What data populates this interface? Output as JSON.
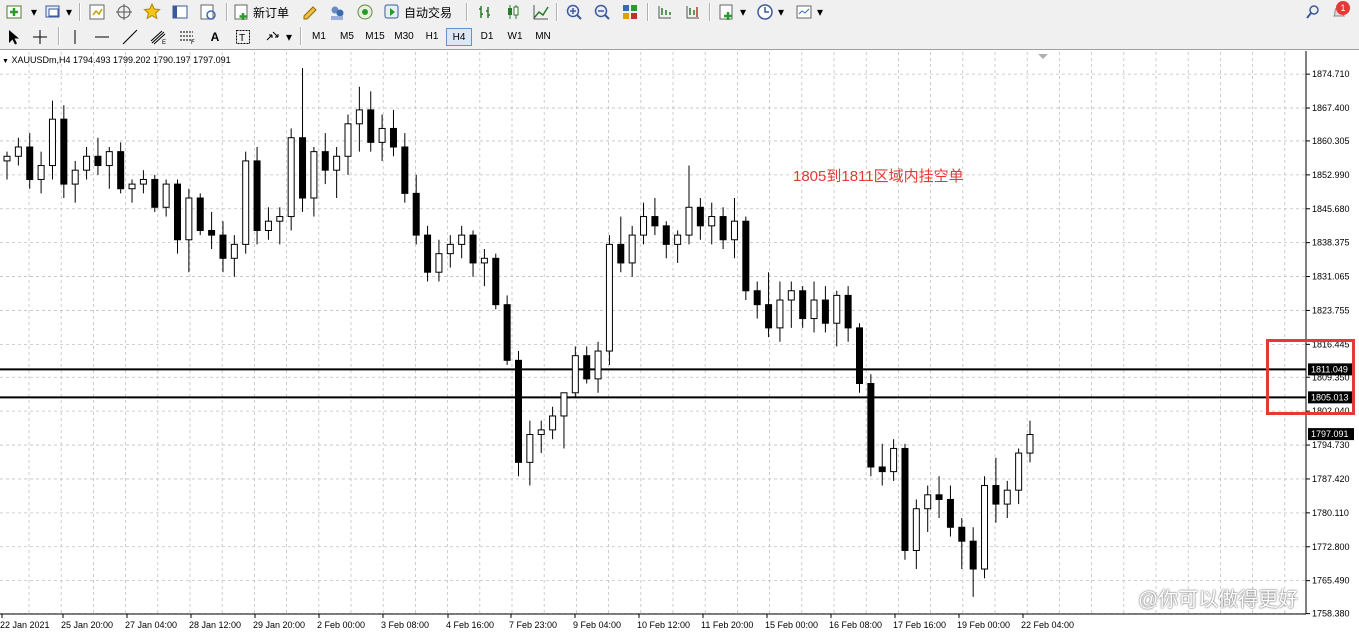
{
  "toolbar": {
    "new_order_label": "新订单",
    "auto_trading_label": "自动交易",
    "notification_count": "1"
  },
  "timeframes": [
    "M1",
    "M5",
    "M15",
    "M30",
    "H1",
    "H4",
    "D1",
    "W1",
    "MN"
  ],
  "active_timeframe": "H4",
  "chart": {
    "header": "XAUUSDm,H4  1794.493 1799.202 1790.197 1797.091",
    "annotation": "1805到1811区域内挂空单",
    "watermark": "@你可以做得更好",
    "current_price_label": "1797.091",
    "line_labels": [
      "1811.049",
      "1805.013"
    ],
    "colors": {
      "background": "#ffffff",
      "grid": "#c0c0c0",
      "candle": "#000000",
      "annotation": "#e53935",
      "highlight": "#e53935"
    }
  },
  "chart_data": {
    "type": "candlestick",
    "symbol": "XAUUSDm",
    "timeframe": "H4",
    "ylim": [
      1758.3,
      1879.7
    ],
    "y_ticks": [
      "1874.710",
      "1867.400",
      "1860.305",
      "1852.990",
      "1845.680",
      "1838.375",
      "1831.065",
      "1823.755",
      "1816.445",
      "1809.350",
      "1802.040",
      "1794.730",
      "1787.420",
      "1780.110",
      "1772.800",
      "1765.490",
      "1758.380"
    ],
    "x_ticks": [
      "22 Jan 2021",
      "25 Jan 20:00",
      "27 Jan 04:00",
      "28 Jan 12:00",
      "29 Jan 20:00",
      "2 Feb 00:00",
      "3 Feb 08:00",
      "4 Feb 16:00",
      "7 Feb 23:00",
      "9 Feb 04:00",
      "10 Feb 12:00",
      "11 Feb 20:00",
      "15 Feb 00:00",
      "16 Feb 08:00",
      "17 Feb 16:00",
      "19 Feb 00:00",
      "22 Feb 04:00"
    ],
    "horizontal_lines": [
      1811.049,
      1805.013
    ],
    "last_price": 1797.091,
    "ohlc": [
      [
        1856,
        1858,
        1852,
        1857
      ],
      [
        1857,
        1861,
        1855,
        1859
      ],
      [
        1859,
        1862,
        1850,
        1852
      ],
      [
        1852,
        1858,
        1849,
        1855
      ],
      [
        1855,
        1869,
        1852,
        1865
      ],
      [
        1865,
        1868,
        1848,
        1851
      ],
      [
        1851,
        1856,
        1847,
        1854
      ],
      [
        1854,
        1859,
        1852,
        1857
      ],
      [
        1857,
        1861,
        1853,
        1855
      ],
      [
        1855,
        1859,
        1850,
        1858
      ],
      [
        1858,
        1860,
        1849,
        1850
      ],
      [
        1850,
        1852,
        1847,
        1851
      ],
      [
        1851,
        1854,
        1849,
        1852
      ],
      [
        1852,
        1853,
        1845,
        1846
      ],
      [
        1846,
        1852,
        1844,
        1851
      ],
      [
        1851,
        1852,
        1836,
        1839
      ],
      [
        1839,
        1850,
        1832,
        1848
      ],
      [
        1848,
        1849,
        1840,
        1841
      ],
      [
        1841,
        1845,
        1837,
        1840
      ],
      [
        1840,
        1843,
        1832,
        1835
      ],
      [
        1835,
        1840,
        1831,
        1838
      ],
      [
        1838,
        1858,
        1836,
        1856
      ],
      [
        1856,
        1859,
        1838,
        1841
      ],
      [
        1841,
        1846,
        1839,
        1843
      ],
      [
        1843,
        1846,
        1838,
        1844
      ],
      [
        1844,
        1863,
        1841,
        1861
      ],
      [
        1861,
        1876,
        1845,
        1848
      ],
      [
        1848,
        1859,
        1844,
        1858
      ],
      [
        1858,
        1862,
        1851,
        1854
      ],
      [
        1854,
        1859,
        1848,
        1857
      ],
      [
        1857,
        1866,
        1853,
        1864
      ],
      [
        1864,
        1872,
        1858,
        1867
      ],
      [
        1867,
        1871,
        1858,
        1860
      ],
      [
        1860,
        1866,
        1856,
        1863
      ],
      [
        1863,
        1867,
        1857,
        1859
      ],
      [
        1859,
        1862,
        1847,
        1849
      ],
      [
        1849,
        1853,
        1838,
        1840
      ],
      [
        1840,
        1842,
        1830,
        1832
      ],
      [
        1832,
        1839,
        1830,
        1836
      ],
      [
        1836,
        1840,
        1833,
        1838
      ],
      [
        1838,
        1842,
        1835,
        1840
      ],
      [
        1840,
        1841,
        1831,
        1834
      ],
      [
        1834,
        1837,
        1829,
        1835
      ],
      [
        1835,
        1836,
        1824,
        1825
      ],
      [
        1825,
        1827,
        1812,
        1813
      ],
      [
        1813,
        1815,
        1788,
        1791
      ],
      [
        1791,
        1800,
        1786,
        1797
      ],
      [
        1797,
        1800,
        1793,
        1798
      ],
      [
        1798,
        1803,
        1796,
        1801
      ],
      [
        1801,
        1806,
        1794,
        1806
      ],
      [
        1806,
        1816,
        1805,
        1814
      ],
      [
        1814,
        1816,
        1808,
        1809
      ],
      [
        1809,
        1817,
        1806,
        1815
      ],
      [
        1815,
        1840,
        1812,
        1838
      ],
      [
        1838,
        1844,
        1832,
        1834
      ],
      [
        1834,
        1842,
        1831,
        1840
      ],
      [
        1840,
        1847,
        1838,
        1844
      ],
      [
        1844,
        1848,
        1840,
        1842
      ],
      [
        1842,
        1843,
        1835,
        1838
      ],
      [
        1838,
        1841,
        1834,
        1840
      ],
      [
        1840,
        1855,
        1838,
        1846
      ],
      [
        1846,
        1848,
        1839,
        1842
      ],
      [
        1842,
        1847,
        1838,
        1844
      ],
      [
        1844,
        1846,
        1837,
        1839
      ],
      [
        1839,
        1848,
        1835,
        1843
      ],
      [
        1843,
        1844,
        1826,
        1828
      ],
      [
        1828,
        1830,
        1822,
        1825
      ],
      [
        1825,
        1832,
        1818,
        1820
      ],
      [
        1820,
        1830,
        1817,
        1826
      ],
      [
        1826,
        1830,
        1820,
        1828
      ],
      [
        1828,
        1829,
        1820,
        1822
      ],
      [
        1822,
        1830,
        1819,
        1826
      ],
      [
        1826,
        1829,
        1819,
        1821
      ],
      [
        1821,
        1828,
        1816,
        1827
      ],
      [
        1827,
        1829,
        1817,
        1820
      ],
      [
        1820,
        1821,
        1806,
        1808
      ],
      [
        1808,
        1810,
        1788,
        1790
      ],
      [
        1790,
        1795,
        1786,
        1789
      ],
      [
        1789,
        1796,
        1787,
        1794
      ],
      [
        1794,
        1795,
        1770,
        1772
      ],
      [
        1772,
        1783,
        1768,
        1781
      ],
      [
        1781,
        1786,
        1776,
        1784
      ],
      [
        1784,
        1788,
        1779,
        1783
      ],
      [
        1783,
        1786,
        1775,
        1777
      ],
      [
        1777,
        1779,
        1768,
        1774
      ],
      [
        1774,
        1777,
        1762,
        1768
      ],
      [
        1768,
        1788,
        1766,
        1786
      ],
      [
        1786,
        1792,
        1778,
        1782
      ],
      [
        1782,
        1787,
        1779,
        1785
      ],
      [
        1785,
        1794,
        1782,
        1793
      ],
      [
        1793,
        1800,
        1791,
        1797
      ]
    ]
  }
}
